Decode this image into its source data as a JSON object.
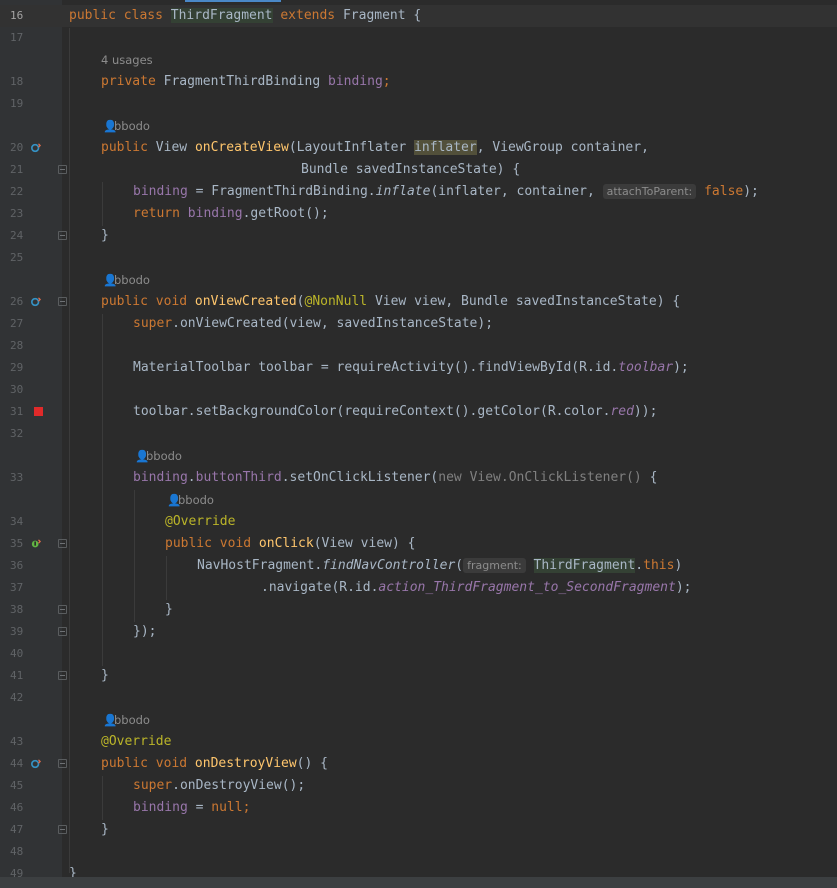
{
  "editor": {
    "lines": {
      "l16": {
        "num": "16",
        "pre": "",
        "public": "public ",
        "class": "class ",
        "classname": "ThirdFragment",
        "extends": " extends ",
        "parent": "Fragment {"
      },
      "l17": {
        "num": "17"
      },
      "usages": "4 usages",
      "l18": {
        "num": "18",
        "kw": "private ",
        "type": "FragmentThirdBinding ",
        "field": "binding",
        "semi": ";"
      },
      "l19": {
        "num": "19"
      },
      "author": "bbodo",
      "l20": {
        "num": "20",
        "kw": "public ",
        "type": "View ",
        "fn": "onCreateView",
        "p1": "(LayoutInflater ",
        "p2": "inflater",
        "p3": ", ViewGroup container,"
      },
      "l21": {
        "num": "21",
        "text": "Bundle savedInstanceState) {"
      },
      "l22": {
        "num": "22",
        "field": "binding",
        "eq": " = FragmentThirdBinding.",
        "call": "inflate",
        "args": "(inflater, container, ",
        "hint": "attachToParent:",
        "kwfalse": "false",
        "end": ");"
      },
      "l23": {
        "num": "23",
        "kw": "return ",
        "field": "binding",
        "rest": ".getRoot();"
      },
      "l24": {
        "num": "24",
        "text": "}"
      },
      "l25": {
        "num": "25"
      },
      "l26": {
        "num": "26",
        "kw": "public void ",
        "fn": "onViewCreated",
        "open": "(",
        "ann": "@NonNull",
        "rest": " View view, Bundle savedInstanceState) {"
      },
      "l27": {
        "num": "27",
        "kw": "super",
        "rest": ".onViewCreated(view, savedInstanceState);"
      },
      "l28": {
        "num": "28"
      },
      "l29": {
        "num": "29",
        "pre": "MaterialToolbar toolbar = requireActivity().findViewById(R.id.",
        "fld": "toolbar",
        "end": ");"
      },
      "l30": {
        "num": "30"
      },
      "l31": {
        "num": "31",
        "pre": "toolbar.setBackgroundColor(requireContext().getColor(R.color.",
        "fld": "red",
        "end": "));"
      },
      "l32": {
        "num": "32"
      },
      "l33": {
        "num": "33",
        "field": "binding",
        "dot": ".",
        "field2": "buttonThird",
        "rest": ".setOnClickListener(",
        "anon": "new View.OnClickListener()",
        "end": " {"
      },
      "l34": {
        "num": "34",
        "ann": "@Override"
      },
      "l35": {
        "num": "35",
        "kw": "public void ",
        "fn": "onClick",
        "rest": "(View view) {"
      },
      "l36": {
        "num": "36",
        "pre": "NavHostFragment.",
        "call": "findNavController",
        "open": "(",
        "hint": "fragment:",
        "cls": "ThirdFragment",
        "dot": ".",
        "kwthis": "this",
        "end": ")"
      },
      "l37": {
        "num": "37",
        "pre": ".navigate(R.id.",
        "fld": "action_ThirdFragment_to_SecondFragment",
        "end": ");"
      },
      "l38": {
        "num": "38",
        "text": "}"
      },
      "l39": {
        "num": "39",
        "text": "});"
      },
      "l40": {
        "num": "40"
      },
      "l41": {
        "num": "41",
        "text": "}"
      },
      "l42": {
        "num": "42"
      },
      "l43": {
        "num": "43",
        "ann": "@Override"
      },
      "l44": {
        "num": "44",
        "kw": "public void ",
        "fn": "onDestroyView",
        "rest": "() {"
      },
      "l45": {
        "num": "45",
        "kw": "super",
        "rest": ".onDestroyView();"
      },
      "l46": {
        "num": "46",
        "field": "binding",
        "eq": " = ",
        "kwnull": "null",
        "semi": ";"
      },
      "l47": {
        "num": "47",
        "text": "}"
      },
      "l48": {
        "num": "48"
      },
      "l49": {
        "num": "49",
        "text": "}"
      }
    }
  },
  "colors": {
    "keyword": "#cc7832",
    "method": "#ffc66d",
    "field": "#9876aa",
    "annotation": "#bbb529",
    "text": "#a9b7c6",
    "background": "#2b2b2b",
    "gutter": "#313335",
    "breakpoint": "#e02a2a"
  }
}
